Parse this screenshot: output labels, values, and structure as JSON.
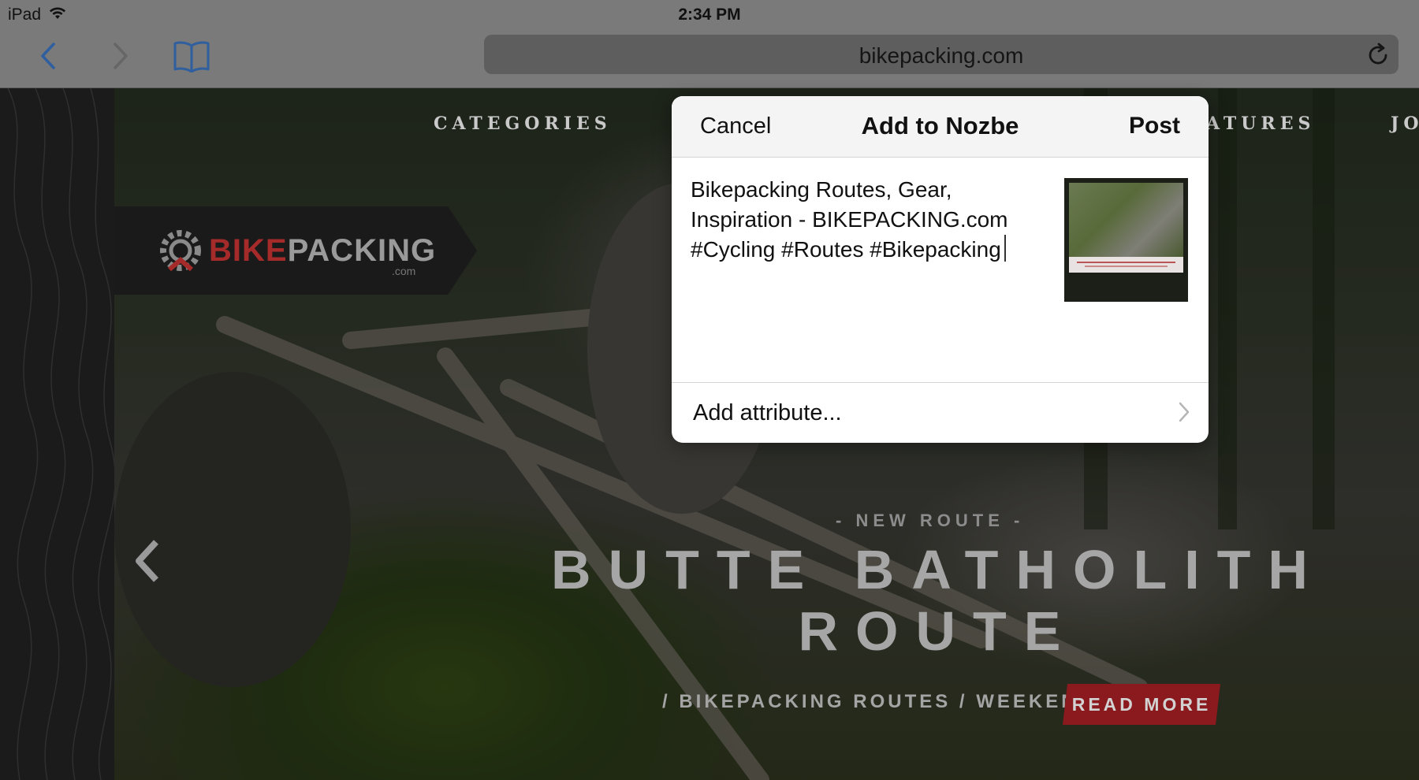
{
  "status_bar": {
    "device": "iPad",
    "time": "2:34 PM"
  },
  "browser": {
    "url": "bikepacking.com",
    "icons": [
      "back-chevron-icon",
      "forward-chevron-icon",
      "bookmarks-book-icon",
      "reload-icon"
    ]
  },
  "site": {
    "nav": {
      "categories": "CATEGORIES",
      "features": "ATURES",
      "journal": "JO"
    },
    "logo": {
      "main_red": "BIKE",
      "main_grey": "PACKING",
      "sub": ".com"
    },
    "hero": {
      "kicker": "- NEW ROUTE -",
      "title_line1": "BUTTE BATHOLITH",
      "title_line2": "ROUTE",
      "breadcrumbs": "/ BIKEPACKING ROUTES / WEEKEND /",
      "read_more": "READ MORE"
    }
  },
  "share_sheet": {
    "cancel_label": "Cancel",
    "title": "Add to Nozbe",
    "post_label": "Post",
    "post_text": "Bikepacking Routes, Gear,\nInspiration - BIKEPACKING.com\n#Cycling #Routes #Bikepacking",
    "attribute_label": "Add attribute..."
  },
  "colors": {
    "accent_red": "#8b1a1f",
    "ios_blue": "#2f6fc8",
    "sheet_bg": "#ffffff",
    "toolbar_dimmed": "#7a7a7a"
  }
}
